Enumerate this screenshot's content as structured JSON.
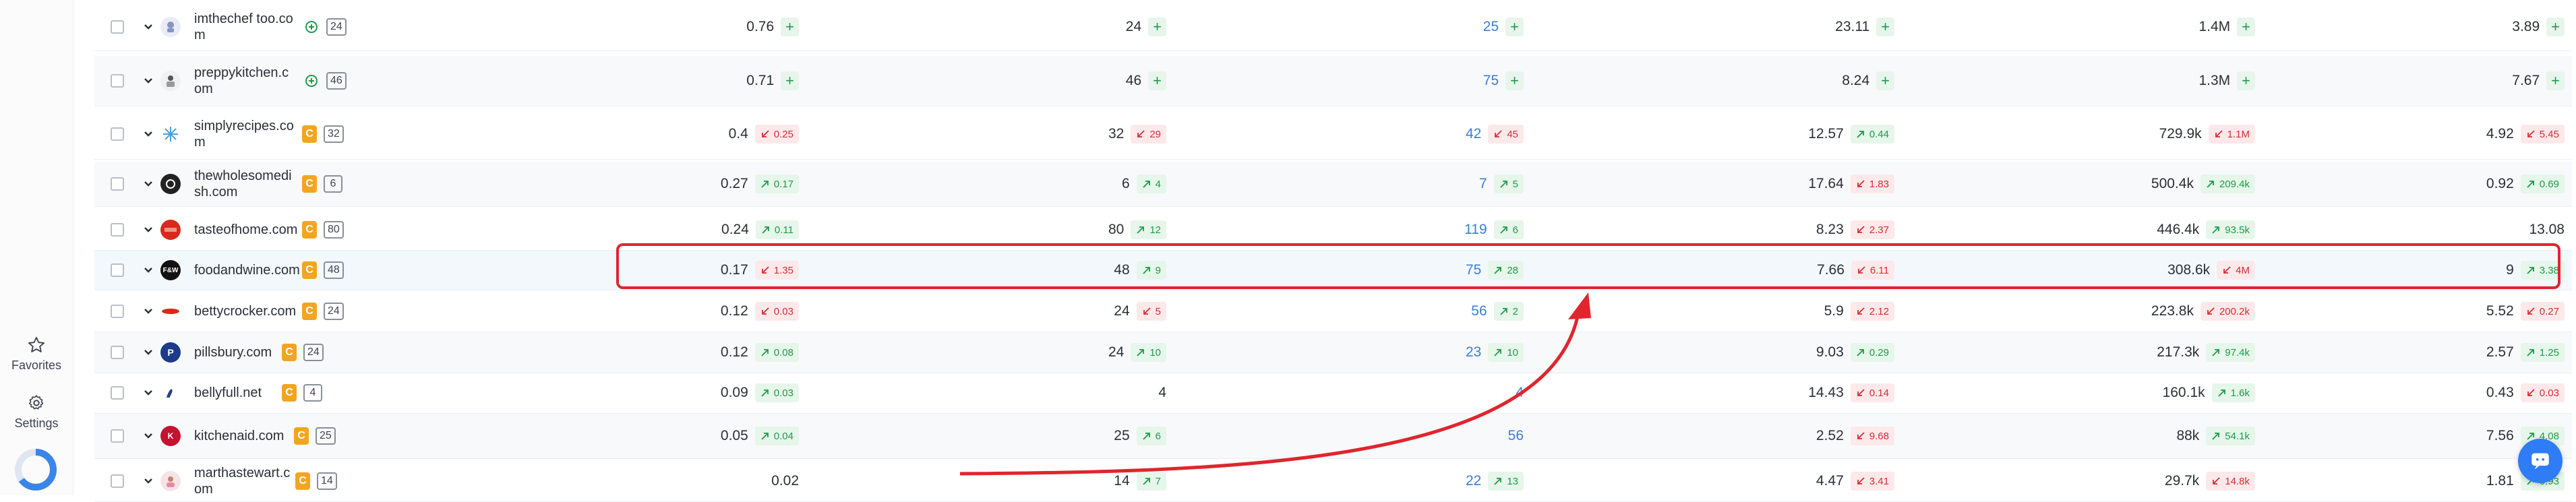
{
  "sidebar": {
    "favorites_label": "Favorites",
    "settings_label": "Settings",
    "progress_fraction": 0.65,
    "progress_color": "#3a86e8"
  },
  "rows": [
    {
      "domain": "imthechef too.com",
      "domain_display": "imthechef too.com",
      "has_badge_c": false,
      "count": "24",
      "added": true,
      "c1": "0.76",
      "c1d": null,
      "c2": "24",
      "c2d": null,
      "c3": "25",
      "c3d": null,
      "c4": "23.11",
      "c4d": null,
      "c5": "1.4M",
      "c5d": null,
      "c6": "3.89",
      "c6d": null,
      "plus": true,
      "favicon": "chef"
    },
    {
      "domain": "preppykitchen.com",
      "has_badge_c": false,
      "count": "46",
      "added": true,
      "c1": "0.71",
      "c1d": null,
      "c2": "46",
      "c2d": null,
      "c3": "75",
      "c3d": null,
      "c4": "8.24",
      "c4d": null,
      "c5": "1.3M",
      "c5d": null,
      "c6": "7.67",
      "c6d": null,
      "plus": true,
      "favicon": "kitchen"
    },
    {
      "domain": "simplyrecipes.com",
      "has_badge_c": true,
      "count": "32",
      "added": false,
      "c1": "0.4",
      "c1d": {
        "dir": "down",
        "v": "0.25"
      },
      "c2": "32",
      "c2d": {
        "dir": "down",
        "v": "29"
      },
      "c3": "42",
      "c3d": {
        "dir": "down",
        "v": "45"
      },
      "c4": "12.57",
      "c4d": {
        "dir": "up",
        "v": "0.44"
      },
      "c5": "729.9k",
      "c5d": {
        "dir": "down",
        "v": "1.1M"
      },
      "c6": "4.92",
      "c6d": {
        "dir": "down",
        "v": "5.45"
      },
      "favicon": "simply"
    },
    {
      "domain": "thewholesomedish.com",
      "has_badge_c": true,
      "count": "6",
      "added": false,
      "c1": "0.27",
      "c1d": {
        "dir": "up",
        "v": "0.17"
      },
      "c2": "6",
      "c2d": {
        "dir": "up",
        "v": "4"
      },
      "c3": "7",
      "c3d": {
        "dir": "up",
        "v": "5"
      },
      "c4": "17.64",
      "c4d": {
        "dir": "down",
        "v": "1.83"
      },
      "c5": "500.4k",
      "c5d": {
        "dir": "up",
        "v": "209.4k"
      },
      "c6": "0.92",
      "c6d": {
        "dir": "up",
        "v": "0.69"
      },
      "favicon": "wholesome"
    },
    {
      "domain": "tasteofhome.com",
      "has_badge_c": true,
      "count": "80",
      "added": false,
      "c1": "0.24",
      "c1d": {
        "dir": "up",
        "v": "0.11"
      },
      "c2": "80",
      "c2d": {
        "dir": "up",
        "v": "12"
      },
      "c3": "119",
      "c3d": {
        "dir": "up",
        "v": "6"
      },
      "c4": "8.23",
      "c4d": {
        "dir": "down",
        "v": "2.37"
      },
      "c5": "446.4k",
      "c5d": {
        "dir": "up",
        "v": "93.5k"
      },
      "c6": "13.08",
      "c6d": null,
      "favicon": "taste"
    },
    {
      "domain": "foodandwine.com",
      "has_badge_c": true,
      "count": "48",
      "added": false,
      "c1": "0.17",
      "c1d": {
        "dir": "down",
        "v": "1.35"
      },
      "c2": "48",
      "c2d": {
        "dir": "up",
        "v": "9"
      },
      "c3": "75",
      "c3d": {
        "dir": "up",
        "v": "28"
      },
      "c4": "7.66",
      "c4d": {
        "dir": "down",
        "v": "6.11"
      },
      "c5": "308.6k",
      "c5d": {
        "dir": "down",
        "v": "4M"
      },
      "c6": "9",
      "c6d": {
        "dir": "up",
        "v": "3.38"
      },
      "favicon": "fw"
    },
    {
      "domain": "bettycrocker.com",
      "has_badge_c": true,
      "count": "24",
      "added": false,
      "c1": "0.12",
      "c1d": {
        "dir": "down",
        "v": "0.03"
      },
      "c2": "24",
      "c2d": {
        "dir": "down",
        "v": "5"
      },
      "c3": "56",
      "c3d": {
        "dir": "up",
        "v": "2"
      },
      "c4": "5.9",
      "c4d": {
        "dir": "down",
        "v": "2.12"
      },
      "c5": "223.8k",
      "c5d": {
        "dir": "down",
        "v": "200.2k"
      },
      "c6": "5.52",
      "c6d": {
        "dir": "down",
        "v": "0.27"
      },
      "favicon": "betty"
    },
    {
      "domain": "pillsbury.com",
      "has_badge_c": true,
      "count": "24",
      "added": false,
      "c1": "0.12",
      "c1d": {
        "dir": "up",
        "v": "0.08"
      },
      "c2": "24",
      "c2d": {
        "dir": "up",
        "v": "10"
      },
      "c3": "23",
      "c3d": {
        "dir": "up",
        "v": "10"
      },
      "c4": "9.03",
      "c4d": {
        "dir": "up",
        "v": "0.29"
      },
      "c5": "217.3k",
      "c5d": {
        "dir": "up",
        "v": "97.4k"
      },
      "c6": "2.57",
      "c6d": {
        "dir": "up",
        "v": "1.25"
      },
      "favicon": "pills"
    },
    {
      "domain": "bellyfull.net",
      "has_badge_c": true,
      "count": "4",
      "added": false,
      "c1": "0.09",
      "c1d": {
        "dir": "up",
        "v": "0.03"
      },
      "c2": "4",
      "c2d": null,
      "c3": "4",
      "c3d": null,
      "c4": "14.43",
      "c4d": {
        "dir": "down",
        "v": "0.14"
      },
      "c5": "160.1k",
      "c5d": {
        "dir": "up",
        "v": "1.6k"
      },
      "c6": "0.43",
      "c6d": {
        "dir": "down",
        "v": "0.03"
      },
      "favicon": "belly"
    },
    {
      "domain": "kitchenaid.com",
      "has_badge_c": true,
      "count": "25",
      "added": false,
      "c1": "0.05",
      "c1d": {
        "dir": "up",
        "v": "0.04"
      },
      "c2": "25",
      "c2d": {
        "dir": "up",
        "v": "6"
      },
      "c3": "56",
      "c3d": null,
      "c4": "2.52",
      "c4d": {
        "dir": "down",
        "v": "9.68"
      },
      "c5": "88k",
      "c5d": {
        "dir": "up",
        "v": "54.1k"
      },
      "c6": "7.56",
      "c6d": {
        "dir": "up",
        "v": "4.08"
      },
      "favicon": "kaid"
    },
    {
      "domain": "marthastewart.com",
      "has_badge_c": true,
      "count": "14",
      "added": false,
      "c1": "0.02",
      "c1d": null,
      "c2": "14",
      "c2d": {
        "dir": "up",
        "v": "7"
      },
      "c3": "22",
      "c3d": {
        "dir": "up",
        "v": "13"
      },
      "c4": "4.47",
      "c4d": {
        "dir": "down",
        "v": "3.41"
      },
      "c5": "29.7k",
      "c5d": {
        "dir": "down",
        "v": "14.8k"
      },
      "c6": "1.81",
      "c6d": {
        "dir": "up",
        "v": "0.93"
      },
      "favicon": "martha"
    }
  ],
  "colors": {
    "accent": "#3a7ed8",
    "up": "#1f9a4a",
    "down": "#d92b35",
    "highlight": "#e0252d",
    "badge_c": "#f3a521"
  }
}
